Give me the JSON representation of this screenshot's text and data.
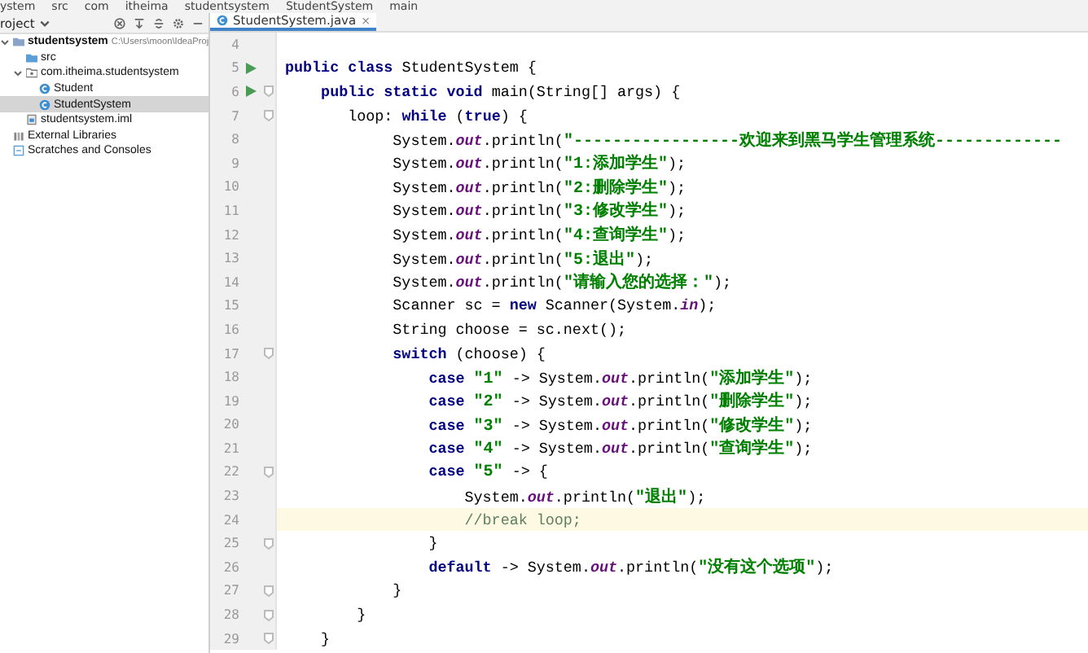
{
  "breadcrumbs": [
    "ystem",
    "src",
    "com",
    "itheima",
    "studentsystem",
    "StudentSystem",
    "main"
  ],
  "project_panel": {
    "title": "roject",
    "tree": [
      {
        "label": "studentsystem",
        "path": "C:\\Users\\moon\\IdeaProj",
        "kind": "module",
        "selected": false,
        "expanded": true,
        "children": [
          {
            "label": "src",
            "kind": "folder",
            "selected": false
          },
          {
            "label": "com.itheima.studentsystem",
            "kind": "package",
            "selected": false,
            "expanded": true,
            "children": [
              {
                "label": "Student",
                "kind": "class",
                "selected": false
              },
              {
                "label": "StudentSystem",
                "kind": "class",
                "selected": true
              }
            ]
          },
          {
            "label": "studentsystem.iml",
            "kind": "file",
            "selected": false
          }
        ]
      },
      {
        "label": "External Libraries",
        "kind": "library",
        "selected": false
      },
      {
        "label": "Scratches and Consoles",
        "kind": "scratch",
        "selected": false
      }
    ]
  },
  "tabs": [
    {
      "label": "StudentSystem.java",
      "selected": true,
      "close": "×"
    }
  ],
  "lines": [
    {
      "number": "4",
      "run": false,
      "fold": false,
      "current": false
    },
    {
      "number": "5",
      "run": true,
      "fold": false,
      "current": false,
      "tokens": [
        {
          "kind": "keyword",
          "text": "public class "
        },
        {
          "kind": "plain",
          "text": "StudentSystem {"
        }
      ]
    },
    {
      "number": "6",
      "run": true,
      "fold": true,
      "current": false,
      "tokens": [
        {
          "kind": "keyword",
          "text": "    public static void "
        },
        {
          "kind": "plain",
          "text": "main(String[] args) {"
        }
      ]
    },
    {
      "number": "7",
      "run": false,
      "fold": true,
      "current": false,
      "tokens": [
        {
          "kind": "plain",
          "text": "       loop: "
        },
        {
          "kind": "keyword",
          "text": "while "
        },
        {
          "kind": "plain",
          "text": "("
        },
        {
          "kind": "keyword",
          "text": "true"
        },
        {
          "kind": "plain",
          "text": ") {"
        }
      ]
    },
    {
      "number": "8",
      "run": false,
      "fold": false,
      "current": false,
      "tokens": [
        {
          "kind": "plain",
          "text": "            System."
        },
        {
          "kind": "field",
          "text": "out"
        },
        {
          "kind": "plain",
          "text": ".println("
        },
        {
          "kind": "string",
          "text": "\"-----------------欢迎来到黑马学生管理系统-------------"
        }
      ]
    },
    {
      "number": "9",
      "run": false,
      "fold": false,
      "current": false,
      "tokens": [
        {
          "kind": "plain",
          "text": "            System."
        },
        {
          "kind": "field",
          "text": "out"
        },
        {
          "kind": "plain",
          "text": ".println("
        },
        {
          "kind": "string",
          "text": "\"1:添加学生\""
        },
        {
          "kind": "plain",
          "text": ");"
        }
      ]
    },
    {
      "number": "10",
      "run": false,
      "fold": false,
      "current": false,
      "tokens": [
        {
          "kind": "plain",
          "text": "            System."
        },
        {
          "kind": "field",
          "text": "out"
        },
        {
          "kind": "plain",
          "text": ".println("
        },
        {
          "kind": "string",
          "text": "\"2:删除学生\""
        },
        {
          "kind": "plain",
          "text": ");"
        }
      ]
    },
    {
      "number": "11",
      "run": false,
      "fold": false,
      "current": false,
      "tokens": [
        {
          "kind": "plain",
          "text": "            System."
        },
        {
          "kind": "field",
          "text": "out"
        },
        {
          "kind": "plain",
          "text": ".println("
        },
        {
          "kind": "string",
          "text": "\"3:修改学生\""
        },
        {
          "kind": "plain",
          "text": ");"
        }
      ]
    },
    {
      "number": "12",
      "run": false,
      "fold": false,
      "current": false,
      "tokens": [
        {
          "kind": "plain",
          "text": "            System."
        },
        {
          "kind": "field",
          "text": "out"
        },
        {
          "kind": "plain",
          "text": ".println("
        },
        {
          "kind": "string",
          "text": "\"4:查询学生\""
        },
        {
          "kind": "plain",
          "text": ");"
        }
      ]
    },
    {
      "number": "13",
      "run": false,
      "fold": false,
      "current": false,
      "tokens": [
        {
          "kind": "plain",
          "text": "            System."
        },
        {
          "kind": "field",
          "text": "out"
        },
        {
          "kind": "plain",
          "text": ".println("
        },
        {
          "kind": "string",
          "text": "\"5:退出\""
        },
        {
          "kind": "plain",
          "text": ");"
        }
      ]
    },
    {
      "number": "14",
      "run": false,
      "fold": false,
      "current": false,
      "tokens": [
        {
          "kind": "plain",
          "text": "            System."
        },
        {
          "kind": "field",
          "text": "out"
        },
        {
          "kind": "plain",
          "text": ".println("
        },
        {
          "kind": "string",
          "text": "\"请输入您的选择：\""
        },
        {
          "kind": "plain",
          "text": ");"
        }
      ]
    },
    {
      "number": "15",
      "run": false,
      "fold": false,
      "current": false,
      "tokens": [
        {
          "kind": "plain",
          "text": "            Scanner sc = "
        },
        {
          "kind": "keyword",
          "text": "new "
        },
        {
          "kind": "plain",
          "text": "Scanner(System."
        },
        {
          "kind": "field",
          "text": "in"
        },
        {
          "kind": "plain",
          "text": ");"
        }
      ]
    },
    {
      "number": "16",
      "run": false,
      "fold": false,
      "current": false,
      "tokens": [
        {
          "kind": "plain",
          "text": "            String choose = sc.next();"
        }
      ]
    },
    {
      "number": "17",
      "run": false,
      "fold": true,
      "current": false,
      "tokens": [
        {
          "kind": "keyword",
          "text": "            switch "
        },
        {
          "kind": "plain",
          "text": "(choose) {"
        }
      ]
    },
    {
      "number": "18",
      "run": false,
      "fold": false,
      "current": false,
      "tokens": [
        {
          "kind": "keyword",
          "text": "                case "
        },
        {
          "kind": "string",
          "text": "\"1\""
        },
        {
          "kind": "plain",
          "text": " -> System."
        },
        {
          "kind": "field",
          "text": "out"
        },
        {
          "kind": "plain",
          "text": ".println("
        },
        {
          "kind": "string",
          "text": "\"添加学生\""
        },
        {
          "kind": "plain",
          "text": ");"
        }
      ]
    },
    {
      "number": "19",
      "run": false,
      "fold": false,
      "current": false,
      "tokens": [
        {
          "kind": "keyword",
          "text": "                case "
        },
        {
          "kind": "string",
          "text": "\"2\""
        },
        {
          "kind": "plain",
          "text": " -> System."
        },
        {
          "kind": "field",
          "text": "out"
        },
        {
          "kind": "plain",
          "text": ".println("
        },
        {
          "kind": "string",
          "text": "\"删除学生\""
        },
        {
          "kind": "plain",
          "text": ");"
        }
      ]
    },
    {
      "number": "20",
      "run": false,
      "fold": false,
      "current": false,
      "tokens": [
        {
          "kind": "keyword",
          "text": "                case "
        },
        {
          "kind": "string",
          "text": "\"3\""
        },
        {
          "kind": "plain",
          "text": " -> System."
        },
        {
          "kind": "field",
          "text": "out"
        },
        {
          "kind": "plain",
          "text": ".println("
        },
        {
          "kind": "string",
          "text": "\"修改学生\""
        },
        {
          "kind": "plain",
          "text": ");"
        }
      ]
    },
    {
      "number": "21",
      "run": false,
      "fold": false,
      "current": false,
      "tokens": [
        {
          "kind": "keyword",
          "text": "                case "
        },
        {
          "kind": "string",
          "text": "\"4\""
        },
        {
          "kind": "plain",
          "text": " -> System."
        },
        {
          "kind": "field",
          "text": "out"
        },
        {
          "kind": "plain",
          "text": ".println("
        },
        {
          "kind": "string",
          "text": "\"查询学生\""
        },
        {
          "kind": "plain",
          "text": ");"
        }
      ]
    },
    {
      "number": "22",
      "run": false,
      "fold": true,
      "current": false,
      "tokens": [
        {
          "kind": "keyword",
          "text": "                case "
        },
        {
          "kind": "string",
          "text": "\"5\""
        },
        {
          "kind": "plain",
          "text": " -> {"
        }
      ]
    },
    {
      "number": "23",
      "run": false,
      "fold": false,
      "current": false,
      "tokens": [
        {
          "kind": "plain",
          "text": "                    System."
        },
        {
          "kind": "field",
          "text": "out"
        },
        {
          "kind": "plain",
          "text": ".println("
        },
        {
          "kind": "string",
          "text": "\"退出\""
        },
        {
          "kind": "plain",
          "text": ");"
        }
      ]
    },
    {
      "number": "24",
      "run": false,
      "fold": false,
      "current": true,
      "tokens": [
        {
          "kind": "comment",
          "text": "                    //break loop;"
        }
      ]
    },
    {
      "number": "25",
      "run": false,
      "fold": true,
      "current": false,
      "tokens": [
        {
          "kind": "plain",
          "text": "                }"
        }
      ]
    },
    {
      "number": "26",
      "run": false,
      "fold": false,
      "current": false,
      "tokens": [
        {
          "kind": "keyword",
          "text": "                default "
        },
        {
          "kind": "plain",
          "text": "-> System."
        },
        {
          "kind": "field",
          "text": "out"
        },
        {
          "kind": "plain",
          "text": ".println("
        },
        {
          "kind": "string",
          "text": "\"没有这个选项\""
        },
        {
          "kind": "plain",
          "text": ");"
        }
      ]
    },
    {
      "number": "27",
      "run": false,
      "fold": true,
      "current": false,
      "tokens": [
        {
          "kind": "plain",
          "text": "            }"
        }
      ]
    },
    {
      "number": "28",
      "run": false,
      "fold": true,
      "current": false,
      "tokens": [
        {
          "kind": "plain",
          "text": "        }"
        }
      ]
    },
    {
      "number": "29",
      "run": false,
      "fold": true,
      "current": false,
      "tokens": [
        {
          "kind": "plain",
          "text": "    }"
        }
      ]
    }
  ]
}
